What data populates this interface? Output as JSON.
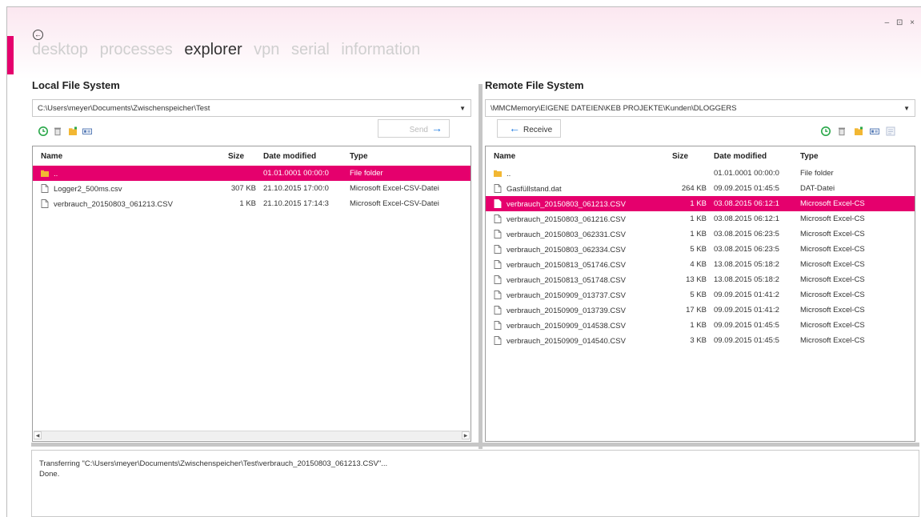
{
  "window": {
    "controls": "– ⊡ ×"
  },
  "nav": {
    "back_label": "←",
    "tabs": [
      "desktop",
      "processes",
      "explorer",
      "vpn",
      "serial",
      "information"
    ],
    "active": "explorer"
  },
  "local": {
    "title": "Local File System",
    "path": "C:\\Users\\meyer\\Documents\\Zwischenspeicher\\Test",
    "send_label": "Send",
    "columns": [
      "Name",
      "Size",
      "Date modified",
      "Type"
    ],
    "files": [
      {
        "name": "..",
        "size": "",
        "date": "01.01.0001 00:00:0",
        "type": "File folder",
        "kind": "folder",
        "selected": true
      },
      {
        "name": "Logger2_500ms.csv",
        "size": "307 KB",
        "date": "21.10.2015 17:00:0",
        "type": "Microsoft Excel-CSV-Datei",
        "kind": "file",
        "selected": false
      },
      {
        "name": "verbrauch_20150803_061213.CSV",
        "size": "1 KB",
        "date": "21.10.2015 17:14:3",
        "type": "Microsoft Excel-CSV-Datei",
        "kind": "file",
        "selected": false
      }
    ]
  },
  "remote": {
    "title": "Remote File System",
    "path": "\\MMCMemory\\EIGENE DATEIEN\\KEB PROJEKTE\\Kunden\\DLOGGERS",
    "receive_label": "Receive",
    "columns": [
      "Name",
      "Size",
      "Date modified",
      "Type"
    ],
    "files": [
      {
        "name": "..",
        "size": "",
        "date": "01.01.0001 00:00:0",
        "type": "File folder",
        "kind": "folder",
        "selected": false
      },
      {
        "name": "Gasfüllstand.dat",
        "size": "264 KB",
        "date": "09.09.2015 01:45:5",
        "type": "DAT-Datei",
        "kind": "file",
        "selected": false
      },
      {
        "name": "verbrauch_20150803_061213.CSV",
        "size": "1 KB",
        "date": "03.08.2015 06:12:1",
        "type": "Microsoft Excel-CS",
        "kind": "file",
        "selected": true
      },
      {
        "name": "verbrauch_20150803_061216.CSV",
        "size": "1 KB",
        "date": "03.08.2015 06:12:1",
        "type": "Microsoft Excel-CS",
        "kind": "file",
        "selected": false
      },
      {
        "name": "verbrauch_20150803_062331.CSV",
        "size": "1 KB",
        "date": "03.08.2015 06:23:5",
        "type": "Microsoft Excel-CS",
        "kind": "file",
        "selected": false
      },
      {
        "name": "verbrauch_20150803_062334.CSV",
        "size": "5 KB",
        "date": "03.08.2015 06:23:5",
        "type": "Microsoft Excel-CS",
        "kind": "file",
        "selected": false
      },
      {
        "name": "verbrauch_20150813_051746.CSV",
        "size": "4 KB",
        "date": "13.08.2015 05:18:2",
        "type": "Microsoft Excel-CS",
        "kind": "file",
        "selected": false
      },
      {
        "name": "verbrauch_20150813_051748.CSV",
        "size": "13 KB",
        "date": "13.08.2015 05:18:2",
        "type": "Microsoft Excel-CS",
        "kind": "file",
        "selected": false
      },
      {
        "name": "verbrauch_20150909_013737.CSV",
        "size": "5 KB",
        "date": "09.09.2015 01:41:2",
        "type": "Microsoft Excel-CS",
        "kind": "file",
        "selected": false
      },
      {
        "name": "verbrauch_20150909_013739.CSV",
        "size": "17 KB",
        "date": "09.09.2015 01:41:2",
        "type": "Microsoft Excel-CS",
        "kind": "file",
        "selected": false
      },
      {
        "name": "verbrauch_20150909_014538.CSV",
        "size": "1 KB",
        "date": "09.09.2015 01:45:5",
        "type": "Microsoft Excel-CS",
        "kind": "file",
        "selected": false
      },
      {
        "name": "verbrauch_20150909_014540.CSV",
        "size": "3 KB",
        "date": "09.09.2015 01:45:5",
        "type": "Microsoft Excel-CS",
        "kind": "file",
        "selected": false
      }
    ]
  },
  "log": {
    "lines": [
      "Transferring \"C:\\Users\\meyer\\Documents\\Zwischenspeicher\\Test\\verbrauch_20150803_061213.CSV\"...",
      "Done."
    ]
  },
  "colors": {
    "accent": "#e5006d",
    "arrow_blue": "#1f7be0",
    "refresh_green": "#2aa84a",
    "folder_yellow": "#f2b733"
  },
  "icons": {
    "toolbar": [
      "refresh-icon",
      "delete-icon",
      "new-folder-icon",
      "rename-icon"
    ],
    "remote_extra": "properties-icon"
  }
}
